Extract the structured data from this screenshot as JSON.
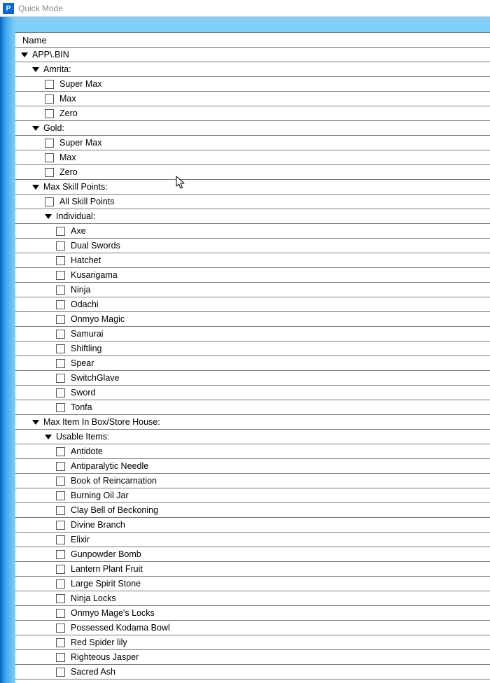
{
  "window": {
    "title": "Quick Mode"
  },
  "header": {
    "name_col": "Name"
  },
  "tree": [
    {
      "type": "expander",
      "indent": 0,
      "label": "APP\\.BIN"
    },
    {
      "type": "expander",
      "indent": 1,
      "label": "Amrita:"
    },
    {
      "type": "check",
      "indent": 2,
      "label": "Super Max"
    },
    {
      "type": "check",
      "indent": 2,
      "label": "Max"
    },
    {
      "type": "check",
      "indent": 2,
      "label": "Zero"
    },
    {
      "type": "expander",
      "indent": 1,
      "label": "Gold:"
    },
    {
      "type": "check",
      "indent": 2,
      "label": "Super Max"
    },
    {
      "type": "check",
      "indent": 2,
      "label": "Max"
    },
    {
      "type": "check",
      "indent": 2,
      "label": "Zero"
    },
    {
      "type": "expander",
      "indent": 1,
      "label": "Max Skill Points:"
    },
    {
      "type": "check",
      "indent": 2,
      "label": "All Skill Points"
    },
    {
      "type": "expander",
      "indent": 2,
      "label": "Individual:"
    },
    {
      "type": "check",
      "indent": 3,
      "label": "Axe"
    },
    {
      "type": "check",
      "indent": 3,
      "label": "Dual Swords"
    },
    {
      "type": "check",
      "indent": 3,
      "label": "Hatchet"
    },
    {
      "type": "check",
      "indent": 3,
      "label": "Kusarigama"
    },
    {
      "type": "check",
      "indent": 3,
      "label": "Ninja"
    },
    {
      "type": "check",
      "indent": 3,
      "label": "Odachi"
    },
    {
      "type": "check",
      "indent": 3,
      "label": "Onmyo Magic"
    },
    {
      "type": "check",
      "indent": 3,
      "label": "Samurai"
    },
    {
      "type": "check",
      "indent": 3,
      "label": "Shiftling"
    },
    {
      "type": "check",
      "indent": 3,
      "label": "Spear"
    },
    {
      "type": "check",
      "indent": 3,
      "label": "SwitchGlave"
    },
    {
      "type": "check",
      "indent": 3,
      "label": "Sword"
    },
    {
      "type": "check",
      "indent": 3,
      "label": "Tonfa"
    },
    {
      "type": "expander",
      "indent": 1,
      "label": "Max Item In Box/Store House:"
    },
    {
      "type": "expander",
      "indent": 2,
      "label": "Usable Items:"
    },
    {
      "type": "check",
      "indent": 3,
      "label": "Antidote"
    },
    {
      "type": "check",
      "indent": 3,
      "label": "Antiparalytic Needle"
    },
    {
      "type": "check",
      "indent": 3,
      "label": "Book of Reincarnation"
    },
    {
      "type": "check",
      "indent": 3,
      "label": "Burning Oil Jar"
    },
    {
      "type": "check",
      "indent": 3,
      "label": "Clay Bell of Beckoning"
    },
    {
      "type": "check",
      "indent": 3,
      "label": "Divine Branch"
    },
    {
      "type": "check",
      "indent": 3,
      "label": "Elixir"
    },
    {
      "type": "check",
      "indent": 3,
      "label": "Gunpowder Bomb"
    },
    {
      "type": "check",
      "indent": 3,
      "label": "Lantern Plant Fruit"
    },
    {
      "type": "check",
      "indent": 3,
      "label": "Large Spirit Stone"
    },
    {
      "type": "check",
      "indent": 3,
      "label": "Ninja Locks"
    },
    {
      "type": "check",
      "indent": 3,
      "label": "Onmyo Mage's Locks"
    },
    {
      "type": "check",
      "indent": 3,
      "label": "Possessed Kodama Bowl"
    },
    {
      "type": "check",
      "indent": 3,
      "label": "Red Spider lily"
    },
    {
      "type": "check",
      "indent": 3,
      "label": "Righteous Jasper"
    },
    {
      "type": "check",
      "indent": 3,
      "label": "Sacred Ash"
    }
  ]
}
